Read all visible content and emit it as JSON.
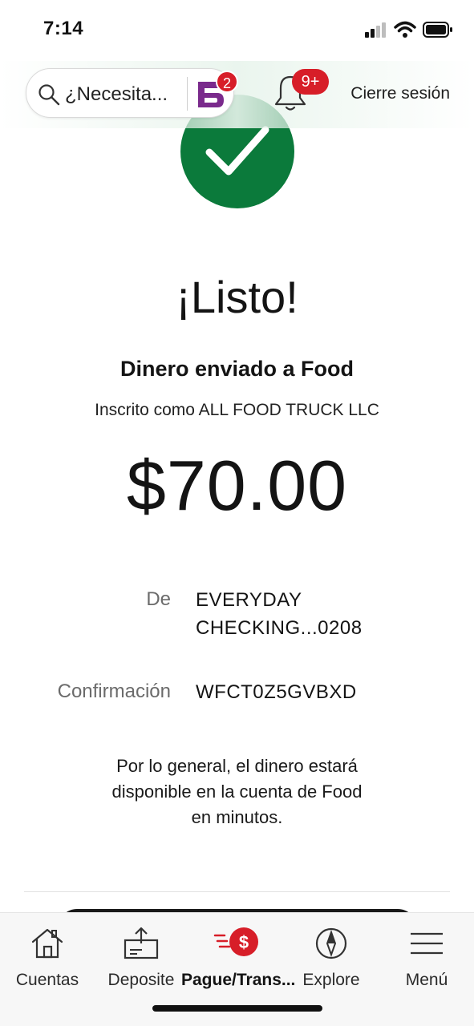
{
  "status_bar": {
    "time": "7:14"
  },
  "header": {
    "search_placeholder": "¿Necesita...",
    "fargo_badge": "2",
    "notifications_badge": "9+",
    "logout_label": "Cierre sesión"
  },
  "confirmation": {
    "title": "¡Listo!",
    "sent_to": "Dinero enviado a Food",
    "enrolled_as": "Inscrito como ALL FOOD TRUCK LLC",
    "amount": "$70.00",
    "from_label": "De",
    "from_value_line1": "EVERYDAY",
    "from_value_line2": "CHECKING...0208",
    "confirmation_label": "Confirmación",
    "confirmation_value": "WFCT0Z5GVBXD",
    "note_line1": "Por lo general, el dinero estará",
    "note_line2": "disponible en la cuenta de Food",
    "note_line3": "en minutos."
  },
  "bottom_nav": {
    "items": [
      {
        "label": "Cuentas",
        "icon": "home-icon"
      },
      {
        "label": "Deposite",
        "icon": "deposit-icon"
      },
      {
        "label": "Pague/Trans...",
        "icon": "pay-transfer-icon",
        "active": true
      },
      {
        "label": "Explore",
        "icon": "compass-icon"
      },
      {
        "label": "Menú",
        "icon": "menu-icon"
      }
    ]
  },
  "colors": {
    "brand_red": "#d71e28",
    "success_green": "#0b7a3b",
    "fargo_purple": "#7a2a8c"
  }
}
